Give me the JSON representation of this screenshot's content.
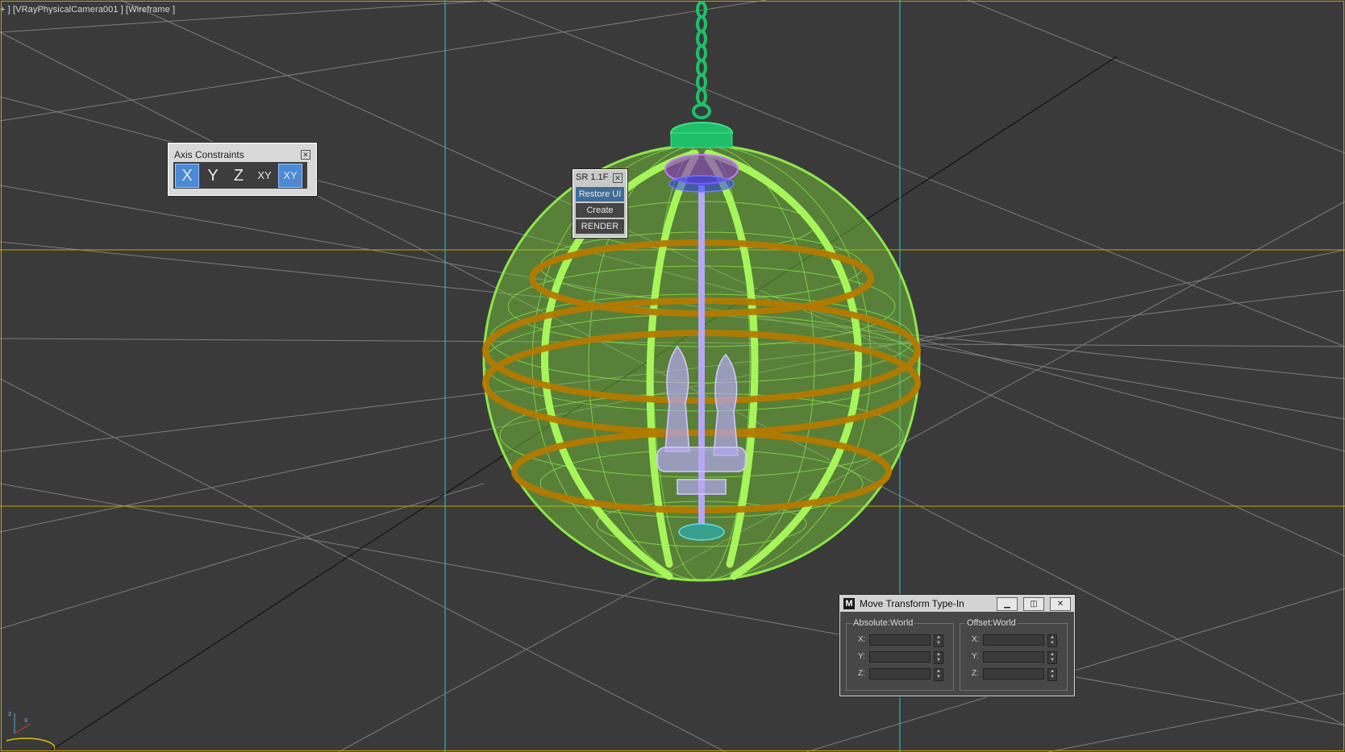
{
  "viewport": {
    "label": "+ ] [VRayPhysicalCamera001 ] [Wireframe ]",
    "render_mode": "Wireframe",
    "colors": {
      "background": "#3a3a3a",
      "grid": "#7a7a7a",
      "safe_frame": "#c8a200",
      "guide": "#22b5c5",
      "sphere_wire": "#86e63a",
      "band": "#b57a00",
      "chain": "#1fbf6a",
      "candles": "#b5a8f0"
    }
  },
  "axis_constraints": {
    "title": "Axis Constraints",
    "close_icon": "close-icon",
    "buttons": [
      {
        "label": "X",
        "active": true
      },
      {
        "label": "Y",
        "active": false
      },
      {
        "label": "Z",
        "active": false
      },
      {
        "label": "XY",
        "active": false
      },
      {
        "label": "XY",
        "active": true,
        "icon": "magnet-icon"
      }
    ]
  },
  "sr_panel": {
    "title": "SR 1.1F",
    "buttons": [
      "Restore UI",
      "Create",
      "RENDER"
    ]
  },
  "move_transform": {
    "title": "Move Transform Type-In",
    "logo": "M",
    "absolute": {
      "label": "Absolute:World",
      "fields": [
        {
          "axis": "X:",
          "value": ""
        },
        {
          "axis": "Y:",
          "value": ""
        },
        {
          "axis": "Z:",
          "value": ""
        }
      ]
    },
    "offset": {
      "label": "Offset:World",
      "fields": [
        {
          "axis": "X:",
          "value": ""
        },
        {
          "axis": "Y:",
          "value": ""
        },
        {
          "axis": "Z:",
          "value": ""
        }
      ]
    }
  },
  "gizmo": {
    "x_label": "x",
    "z_label": "z"
  }
}
